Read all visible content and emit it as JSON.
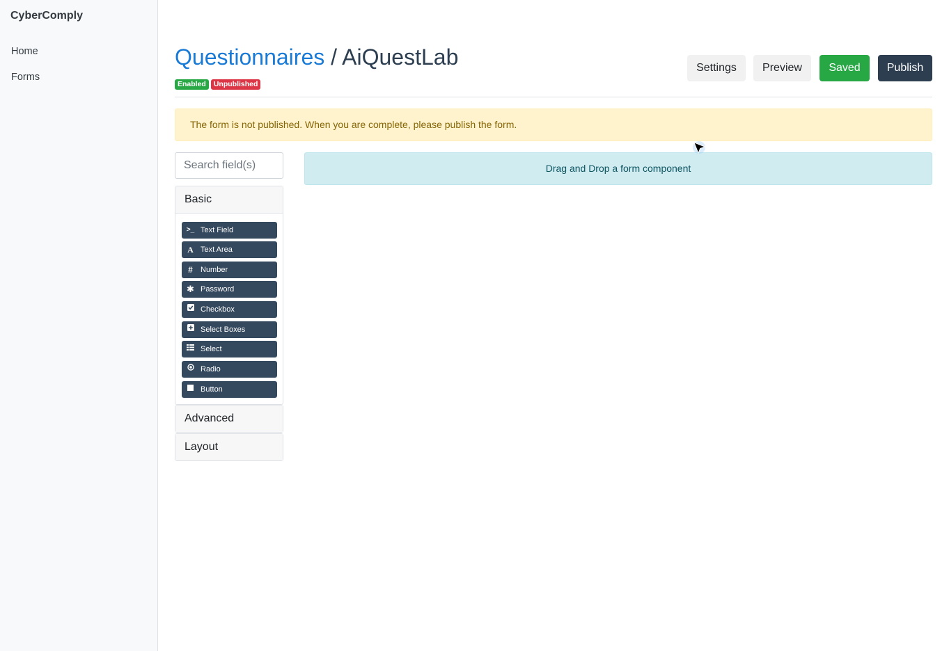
{
  "app": {
    "brand": "CyberComply"
  },
  "sidebar": {
    "items": [
      {
        "label": "Home"
      },
      {
        "label": "Forms"
      }
    ]
  },
  "header": {
    "breadcrumb_link": "Questionnaires",
    "separator": " / ",
    "form_name": "AiQuestLab",
    "badges": [
      {
        "label": "Enabled",
        "color": "#28a745"
      },
      {
        "label": "Unpublished",
        "color": "#dc3545"
      }
    ],
    "buttons": {
      "settings": "Settings",
      "preview": "Preview",
      "saved": "Saved",
      "publish": "Publish"
    }
  },
  "alert": {
    "text": "The form is not published. When you are complete, please publish the form."
  },
  "builder": {
    "search_placeholder": "Search field(s)",
    "groups": {
      "basic": {
        "label": "Basic",
        "components": [
          {
            "label": "Text Field",
            "icon": "terminal-icon"
          },
          {
            "label": "Text Area",
            "icon": "font-icon"
          },
          {
            "label": "Number",
            "icon": "hashtag-icon"
          },
          {
            "label": "Password",
            "icon": "asterisk-icon"
          },
          {
            "label": "Checkbox",
            "icon": "check-square-icon"
          },
          {
            "label": "Select Boxes",
            "icon": "plus-square-icon"
          },
          {
            "label": "Select",
            "icon": "list-icon"
          },
          {
            "label": "Radio",
            "icon": "dot-circle-icon"
          },
          {
            "label": "Button",
            "icon": "stop-icon"
          }
        ]
      },
      "advanced": {
        "label": "Advanced"
      },
      "layout": {
        "label": "Layout"
      }
    },
    "dropzone_text": "Drag and Drop a form component"
  },
  "colors": {
    "primary": "#2c3e50",
    "link": "#1a7bd6",
    "success": "#28a745",
    "danger": "#dc3545"
  }
}
